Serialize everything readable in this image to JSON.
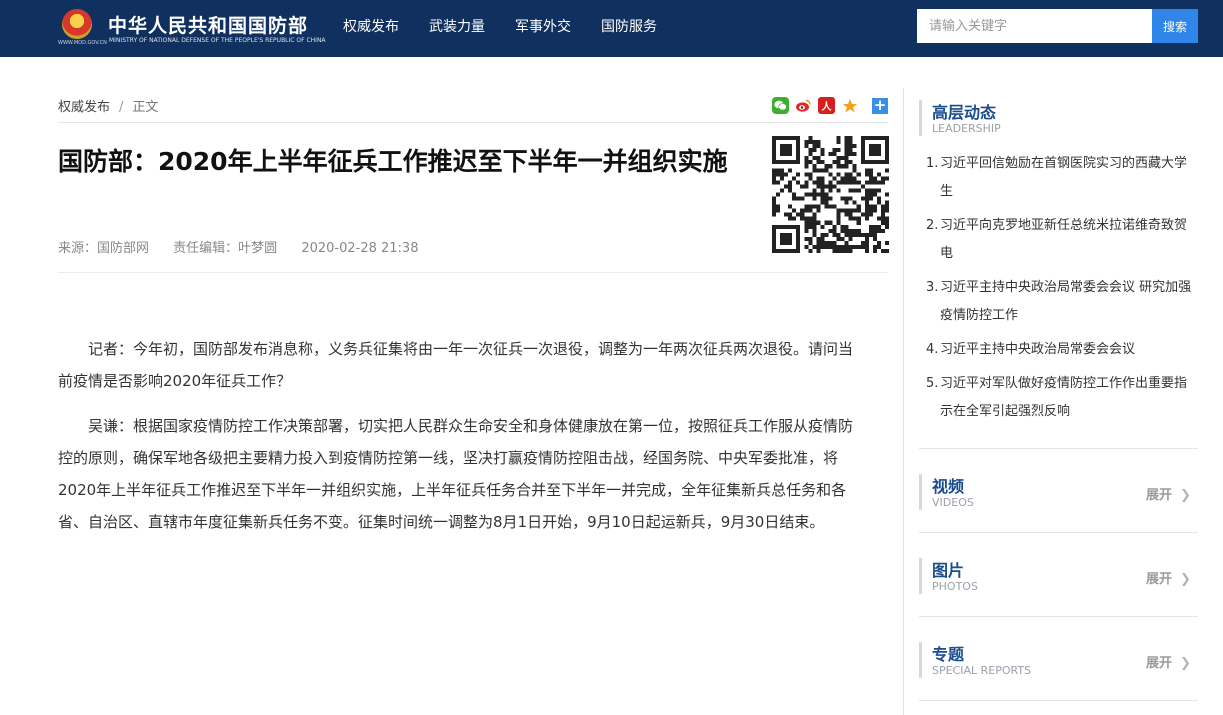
{
  "header": {
    "site_name": "中华人民共和国国防部",
    "site_name_en": "MINISTRY OF NATIONAL DEFENSE OF THE PEOPLE'S REPUBLIC OF CHINA",
    "site_url": "WWW.MOD.GOV.CN",
    "nav": [
      "权威发布",
      "武装力量",
      "军事外交",
      "国防服务"
    ],
    "search_placeholder": "请输入关键字",
    "search_button": "搜索",
    "bg_color": "#10315f",
    "accent_color": "#2f86e8"
  },
  "breadcrumb": {
    "section": "权威发布",
    "separator": "/",
    "current": "正文"
  },
  "share": {
    "icons": [
      "wechat-icon",
      "weibo-icon",
      "people-icon",
      "favorite-icon",
      "share-more-icon"
    ],
    "people_glyph": "人",
    "more_glyph": "+"
  },
  "article": {
    "title": "国防部：2020年上半年征兵工作推迟至下半年一并组织实施",
    "source": "来源：国防部网",
    "editor": "责任编辑：叶梦圆",
    "datetime": "2020-02-28 21:38",
    "paragraphs": [
      "记者：今年初，国防部发布消息称，义务兵征集将由一年一次征兵一次退役，调整为一年两次征兵两次退役。请问当前疫情是否影响2020年征兵工作？",
      "吴谦：根据国家疫情防控工作决策部署，切实把人民群众生命安全和身体健康放在第一位，按照征兵工作服从疫情防控的原则，确保军地各级把主要精力投入到疫情防控第一线，坚决打赢疫情防控阻击战，经国务院、中央军委批准，将2020年上半年征兵工作推迟至下半年一并组织实施，上半年征兵任务合并至下半年一并完成，全年征集新兵总任务和各省、自治区、直辖市年度征集新兵任务不变。征集时间统一调整为8月1日开始，9月10日起运新兵，9月30日结束。"
    ]
  },
  "sidebar": {
    "leadership": {
      "title": "高层动态",
      "subtitle": "LEADERSHIP",
      "items": [
        {
          "num": "1.",
          "text": "习近平回信勉励在首钢医院实习的西藏大学生"
        },
        {
          "num": "2.",
          "text": "习近平向克罗地亚新任总统米拉诺维奇致贺电"
        },
        {
          "num": "3.",
          "text": "习近平主持中央政治局常委会会议 研究加强疫情防控工作"
        },
        {
          "num": "4.",
          "text": "习近平主持中央政治局常委会会议"
        },
        {
          "num": "5.",
          "text": "习近平对军队做好疫情防控工作作出重要指示在全军引起强烈反响"
        }
      ]
    },
    "sections": [
      {
        "title": "视频",
        "subtitle": "VIDEOS",
        "expand": "展开"
      },
      {
        "title": "图片",
        "subtitle": "PHOTOS",
        "expand": "展开"
      },
      {
        "title": "专题",
        "subtitle": "SPECIAL REPORTS",
        "expand": "展开"
      }
    ],
    "title_color": "#1b4d8d"
  }
}
